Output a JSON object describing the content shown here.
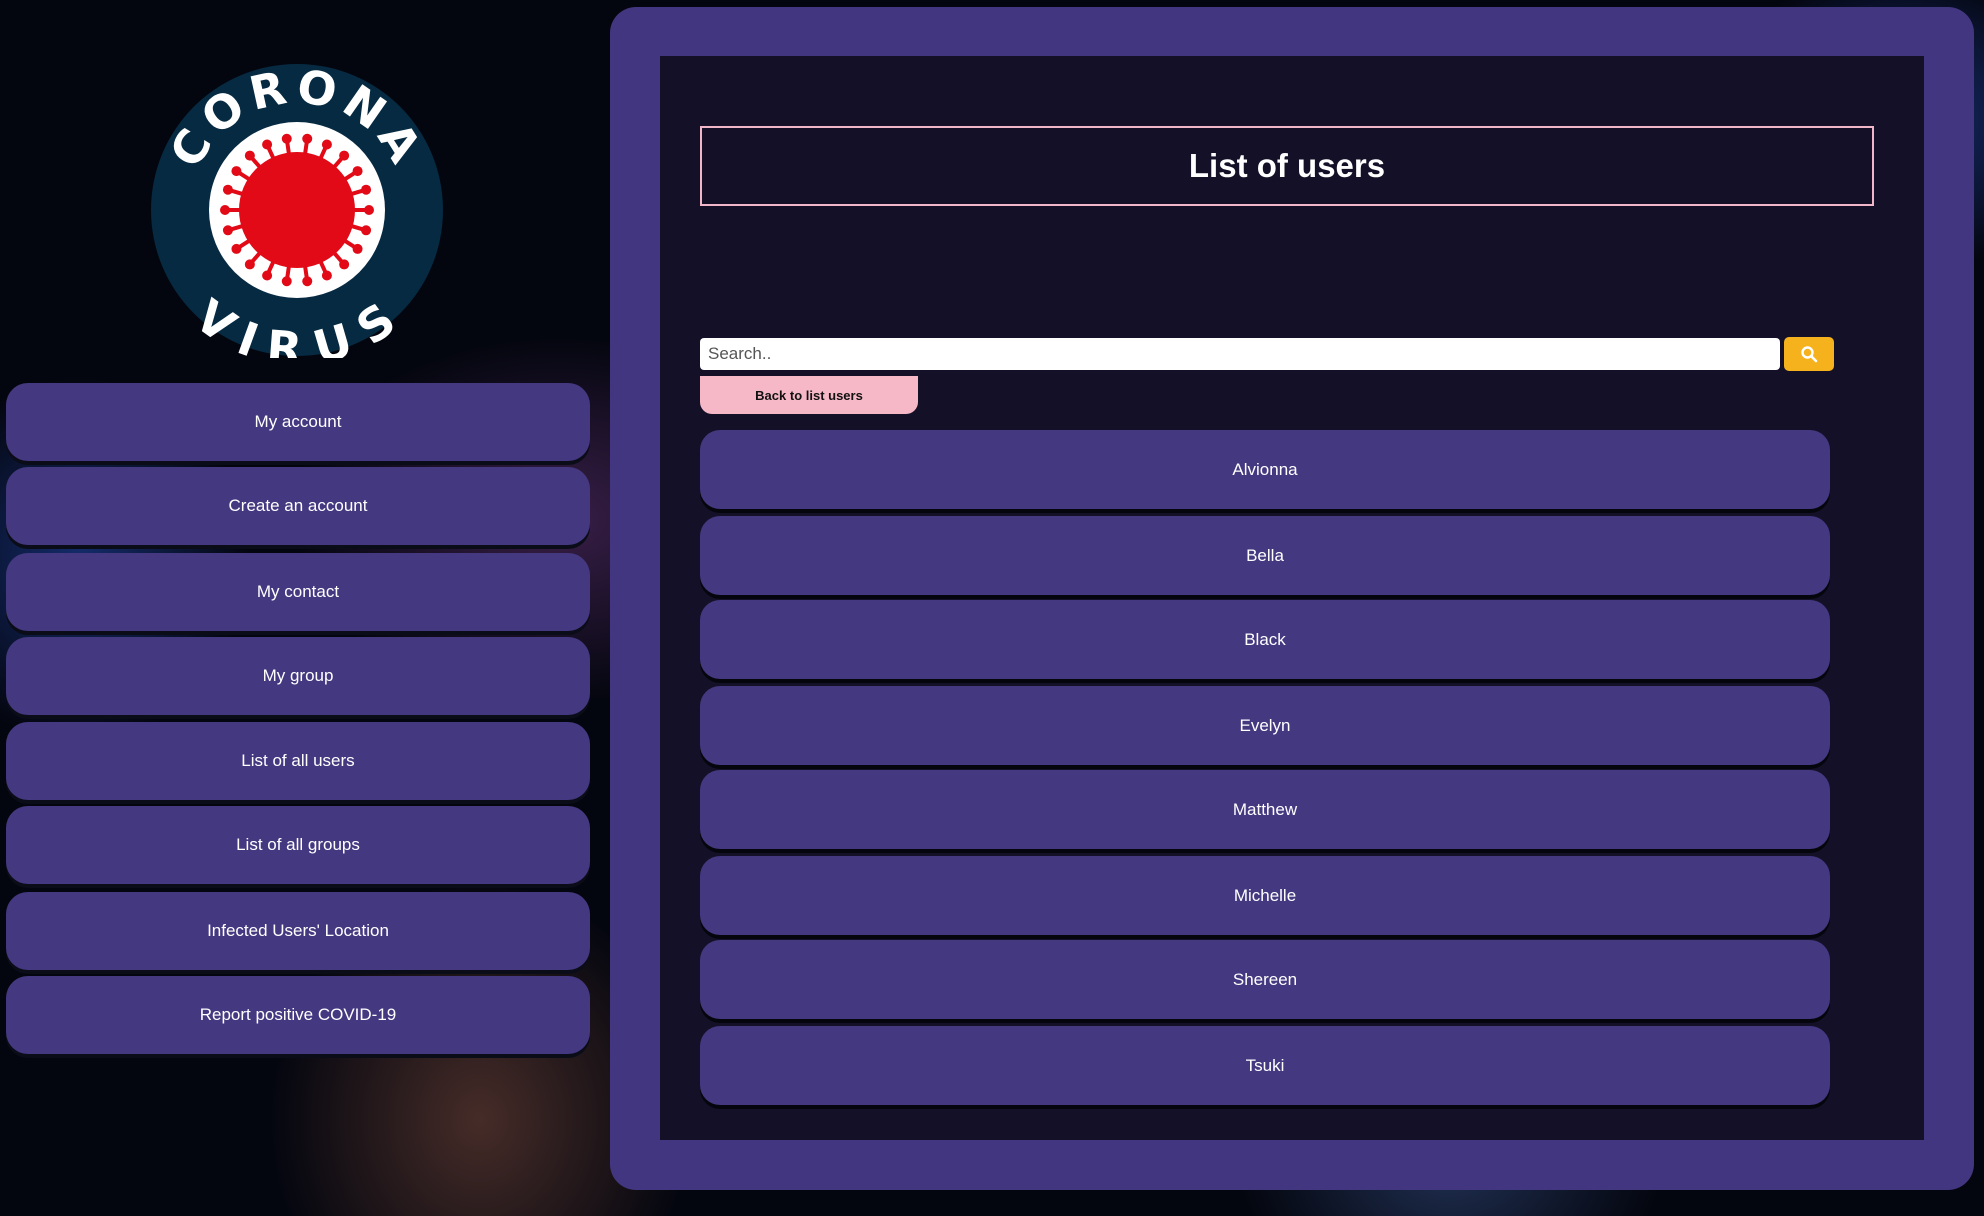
{
  "logo": {
    "top_text": "CORONA",
    "bottom_text": "VIRUS",
    "colors": {
      "ring": "#062a42",
      "inner": "#ffffff",
      "virus": "#e10a16"
    }
  },
  "sidebar": {
    "items": [
      {
        "label": "My account"
      },
      {
        "label": "Create an account"
      },
      {
        "label": "My contact"
      },
      {
        "label": "My group"
      },
      {
        "label": "List of all users"
      },
      {
        "label": "List of all groups"
      },
      {
        "label": "Infected Users' Location"
      },
      {
        "label": "Report positive COVID-19"
      }
    ]
  },
  "main": {
    "title": "List of users",
    "search": {
      "placeholder": "Search..",
      "value": "",
      "button_icon": "search-icon"
    },
    "back_button": "Back to list users",
    "users": [
      "Alvionna",
      "Bella",
      "Black",
      "Evelyn",
      "Matthew",
      "Michelle",
      "Shereen",
      "Tsuki"
    ]
  },
  "colors": {
    "accent": "#443880",
    "search_button": "#f5b21d",
    "back_button": "#f6b8c7",
    "panel": "#433680",
    "inner": "#141027"
  }
}
